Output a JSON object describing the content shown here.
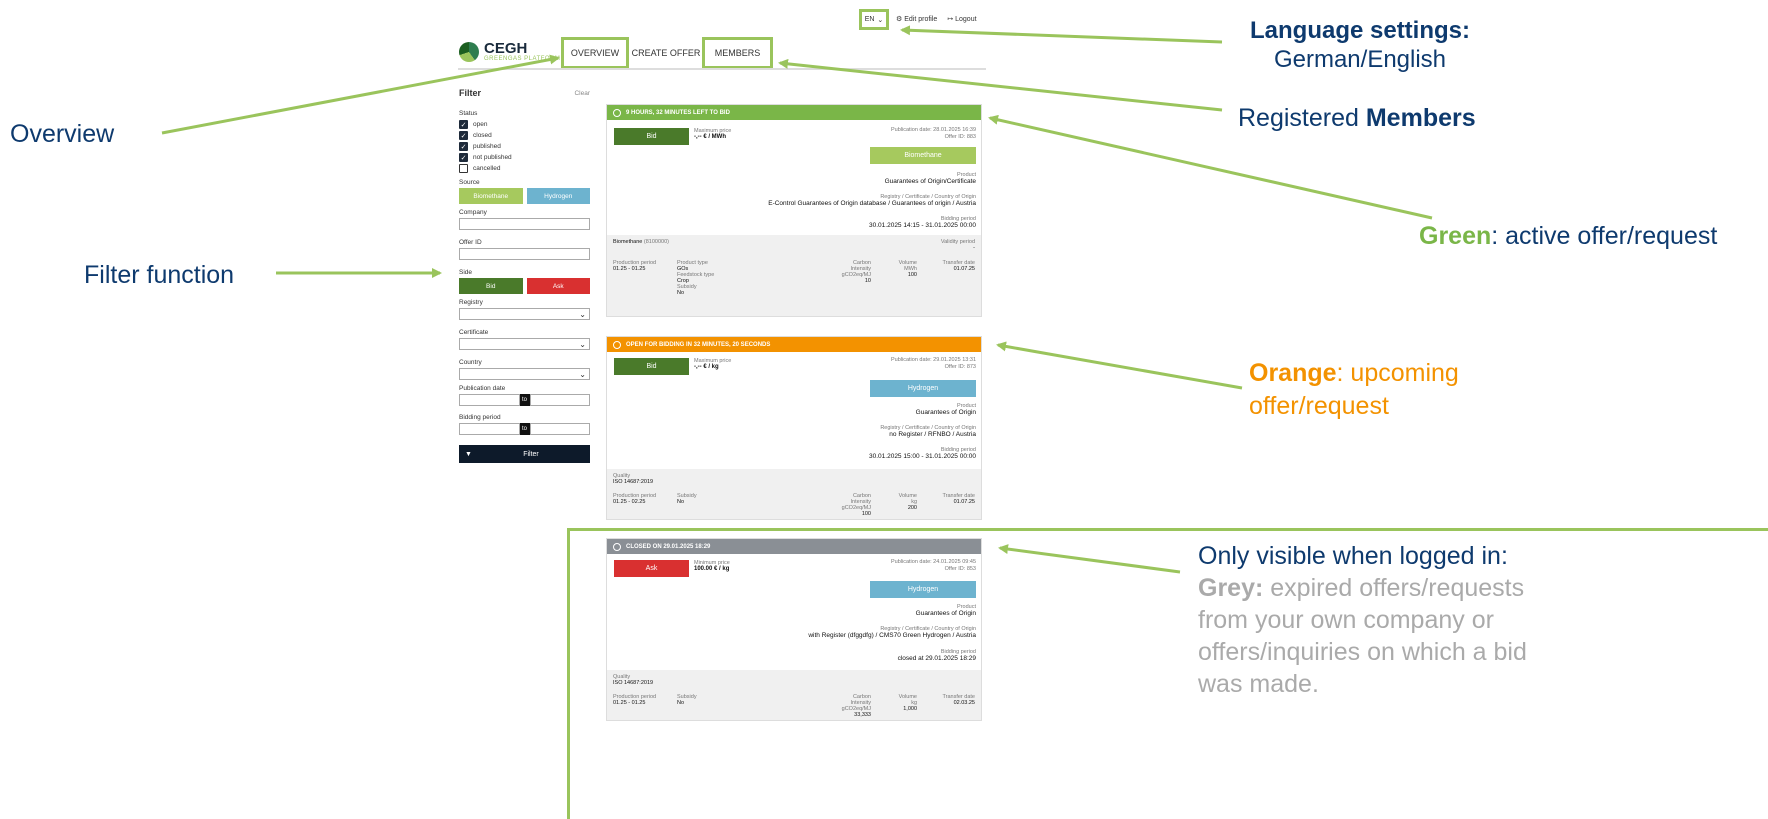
{
  "topbar": {
    "language": "EN",
    "edit_profile": "Edit profile",
    "logout": "Logout"
  },
  "logo": {
    "title": "CEGH",
    "subtitle": "GREENGAS PLATFORM"
  },
  "nav": {
    "overview": "OVERVIEW",
    "create_offer": "CREATE OFFER",
    "members": "MEMBERS"
  },
  "filter": {
    "title": "Filter",
    "clear": "Clear",
    "status_label": "Status",
    "statuses": [
      {
        "label": "open",
        "checked": true
      },
      {
        "label": "closed",
        "checked": true
      },
      {
        "label": "published",
        "checked": true
      },
      {
        "label": "not published",
        "checked": true
      },
      {
        "label": "cancelled",
        "checked": false
      }
    ],
    "source_label": "Source",
    "source_biomethane": "Biomethane",
    "source_hydrogen": "Hydrogen",
    "company_label": "Company",
    "offer_id_label": "Offer ID",
    "side_label": "Side",
    "bid": "Bid",
    "ask": "Ask",
    "registry_label": "Registry",
    "certificate_label": "Certificate",
    "country_label": "Country",
    "publication_date_label": "Publication date",
    "bidding_period_label": "Bidding period",
    "to": "to",
    "filter_button": "Filter"
  },
  "cards": [
    {
      "bar_text": "9 HOURS, 32 MINUTES LEFT TO BID",
      "bar_color": "#7ab648",
      "side": "Bid",
      "side_color": "#4a7a2a",
      "price_label": "Maximum price",
      "price": "-,-- € / MWh",
      "publication": "Publication date: 28.01.2025 16:39",
      "offer_id": "Offer ID: 883",
      "source": "Biomethane",
      "source_color": "#a6c95e",
      "product_label": "Product",
      "product": "Guarantees of Origin/Certificate",
      "registry_label": "Registry / Certificate / Country of Origin",
      "registry": "E-Control Guarantees of Origin database / Guarantees of origin / Austria",
      "bidding_label": "Bidding period",
      "bidding": "30.01.2025 14:15 - 31.01.2025 00:00",
      "foot_title": "Biomethane",
      "foot_title_extra": "(8100000)",
      "validity_label": "Validity period",
      "validity": "-",
      "prod_period_label": "Production period",
      "prod_period": "01.25 - 01.25",
      "product_type_label": "Product type",
      "product_type": "GOs",
      "feedstock_label": "Feedstock type",
      "feedstock": "Crop",
      "subsidy_label": "Subsidy",
      "subsidy": "No",
      "ci_label": "Carbon Intensity",
      "ci_unit": "gCO2eq/MJ",
      "ci": "10",
      "vol_label": "Volume",
      "vol_unit": "MWh",
      "vol": "100",
      "transfer_label": "Transfer date",
      "transfer": "01.07.25"
    },
    {
      "bar_text": "OPEN FOR BIDDING IN 32 MINUTES, 20 SECONDS",
      "bar_color": "#f39200",
      "side": "Bid",
      "side_color": "#4a7a2a",
      "price_label": "Maximum price",
      "price": "-,-- € / kg",
      "publication": "Publication date: 29.01.2025 13:31",
      "offer_id": "Offer ID: 873",
      "source": "Hydrogen",
      "source_color": "#6db3cf",
      "product_label": "Product",
      "product": "Guarantees of Origin",
      "registry_label": "Registry / Certificate / Country of Origin",
      "registry": "no Register / RFNBO / Austria",
      "bidding_label": "Bidding period",
      "bidding": "30.01.2025 15:00 - 31.01.2025 00:00",
      "quality_label": "Quality",
      "quality": "ISO 14687:2019",
      "prod_period_label": "Production period",
      "prod_period": "01.25 - 02.25",
      "subsidy_label": "Subsidy",
      "subsidy": "No",
      "ci_label": "Carbon Intensity",
      "ci_unit": "gCO2eq/MJ",
      "ci": "100",
      "vol_label": "Volume",
      "vol_unit": "kg",
      "vol": "200",
      "transfer_label": "Transfer date",
      "transfer": "01.07.25"
    },
    {
      "bar_text": "CLOSED ON 29.01.2025 18:29",
      "bar_color": "#8a8f95",
      "side": "Ask",
      "side_color": "#d93030",
      "price_label": "Minimum price",
      "price": "100.00 € / kg",
      "publication": "Publication date: 24.01.2025 09:45",
      "offer_id": "Offer ID: 853",
      "source": "Hydrogen",
      "source_color": "#6db3cf",
      "product_label": "Product",
      "product": "Guarantees of Origin",
      "registry_label": "Registry / Certificate / Country of Origin",
      "registry": "with Register (dfggdfg) / CMS70 Green Hydrogen / Austria",
      "bidding_label": "Bidding period",
      "bidding": "closed at 29.01.2025 18:29",
      "quality_label": "Quality",
      "quality": "ISO 14687:2019",
      "prod_period_label": "Production period",
      "prod_period": "01.25 - 01.25",
      "subsidy_label": "Subsidy",
      "subsidy": "No",
      "ci_label": "Carbon Intensity",
      "ci_unit": "gCO2eq/MJ",
      "ci": "33,333",
      "vol_label": "Volume",
      "vol_unit": "kg",
      "vol": "1,000",
      "transfer_label": "Transfer date",
      "transfer": "02.03.25"
    }
  ],
  "annotations": {
    "language_title": "Language settings:",
    "language_sub": "German/English",
    "members_pre": "Registered ",
    "members_bold": "Members",
    "overview": "Overview",
    "filter": "Filter function",
    "green_bold": "Green",
    "green_rest": ": active offer/request",
    "orange_bold": "Orange",
    "orange_rest": ": upcoming",
    "orange_line2": "offer/request",
    "grey_l1": "Only visible when logged in:",
    "grey_bold": "Grey:",
    "grey_l2": " expired offers/requests",
    "grey_l3": "from your own company or",
    "grey_l4": "offers/inquiries on which a bid",
    "grey_l5": "was made."
  },
  "colors": {
    "accent": "#9ac45c",
    "annotation_blue": "#0e3a6e",
    "orange": "#f39200",
    "grey": "#aaaaaa"
  }
}
